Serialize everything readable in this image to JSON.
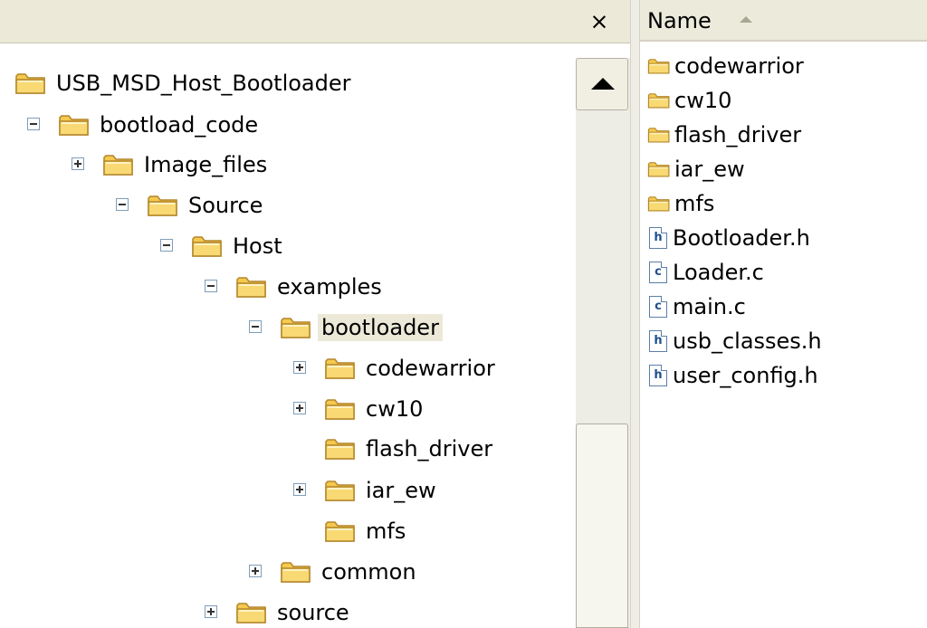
{
  "tree": {
    "close_glyph": "×",
    "items": [
      {
        "label": "USB_MSD_Host_Bootloader",
        "expander": "none",
        "selected": false
      },
      {
        "label": "bootload_code",
        "expander": "minus",
        "selected": false
      },
      {
        "label": "Image_files",
        "expander": "plus",
        "selected": false
      },
      {
        "label": "Source",
        "expander": "minus",
        "selected": false
      },
      {
        "label": "Host",
        "expander": "minus",
        "selected": false
      },
      {
        "label": "examples",
        "expander": "minus",
        "selected": false
      },
      {
        "label": "bootloader",
        "expander": "minus",
        "selected": true
      },
      {
        "label": "codewarrior",
        "expander": "plus",
        "selected": false
      },
      {
        "label": "cw10",
        "expander": "plus",
        "selected": false
      },
      {
        "label": "flash_driver",
        "expander": "none",
        "selected": false
      },
      {
        "label": "iar_ew",
        "expander": "plus",
        "selected": false
      },
      {
        "label": "mfs",
        "expander": "none",
        "selected": false
      },
      {
        "label": "common",
        "expander": "plus",
        "selected": false
      },
      {
        "label": "source",
        "expander": "plus",
        "selected": false
      }
    ]
  },
  "list": {
    "column_name": "Name",
    "sort": "ascending",
    "items": [
      {
        "label": "codewarrior",
        "icon": "folder-icon"
      },
      {
        "label": "cw10",
        "icon": "folder-icon"
      },
      {
        "label": "flash_driver",
        "icon": "folder-icon"
      },
      {
        "label": "iar_ew",
        "icon": "folder-icon"
      },
      {
        "label": "mfs",
        "icon": "folder-icon"
      },
      {
        "label": "Bootloader.h",
        "icon": "h-file-icon",
        "glyph": "h"
      },
      {
        "label": "Loader.c",
        "icon": "c-file-icon",
        "glyph": "c"
      },
      {
        "label": "main.c",
        "icon": "c-file-icon",
        "glyph": "c"
      },
      {
        "label": "usb_classes.h",
        "icon": "h-file-icon",
        "glyph": "h"
      },
      {
        "label": "user_config.h",
        "icon": "h-file-icon",
        "glyph": "h"
      }
    ]
  },
  "colors": {
    "folder_body": "#f4c94e",
    "folder_edge": "#b3862b",
    "selection": "#ece9d8",
    "pane_header": "#ece9d8"
  }
}
